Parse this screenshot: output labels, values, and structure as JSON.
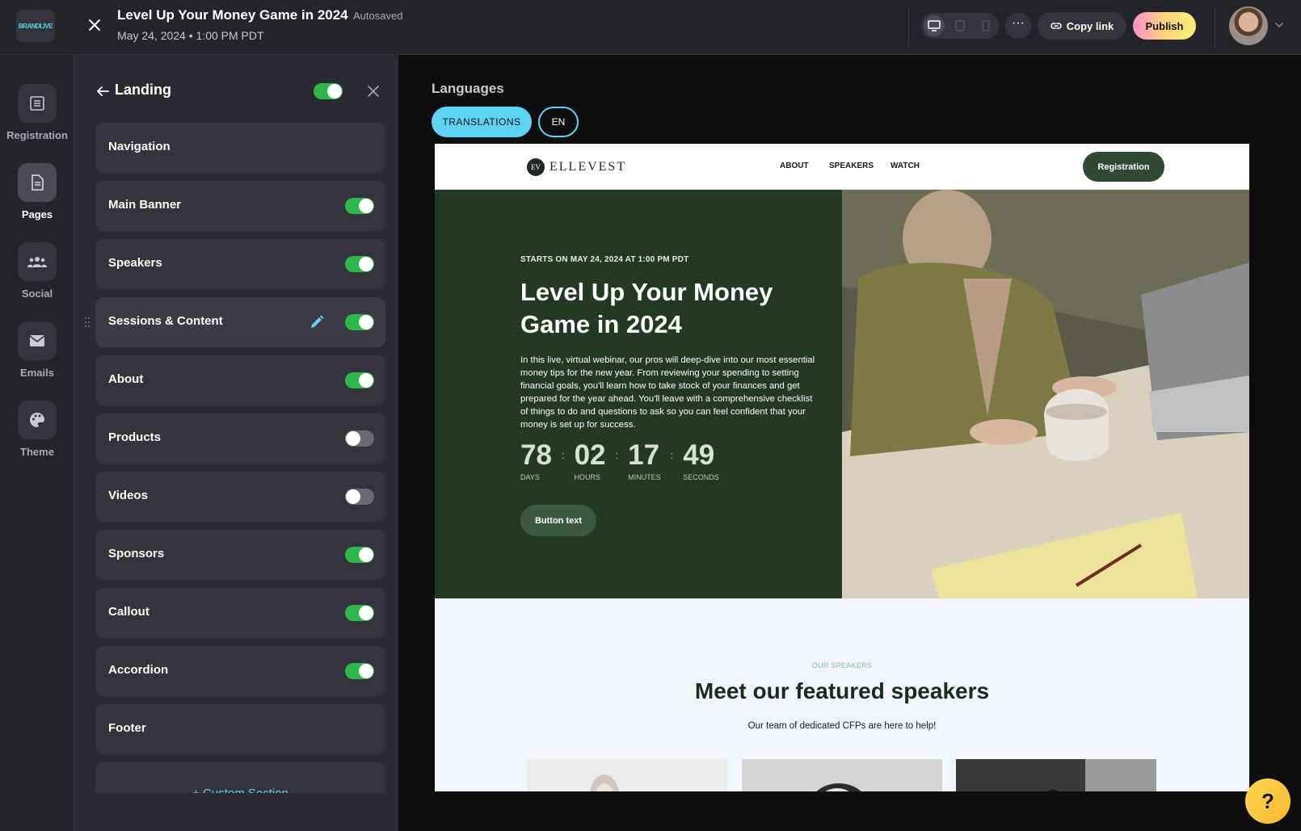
{
  "app": {
    "logo_text": "BRANDLIVE",
    "title": "Level Up Your Money Game in 2024",
    "autosave_status": "Autosaved",
    "date": "May 24, 2024 • 1:00 PM PDT"
  },
  "toolbar": {
    "more_label": "···",
    "copy_link_label": "Copy link",
    "publish_label": "Publish"
  },
  "rail": {
    "items": [
      {
        "label": "Registration",
        "icon": "list-icon"
      },
      {
        "label": "Pages",
        "icon": "document-icon",
        "active": true
      },
      {
        "label": "Social",
        "icon": "people-icon"
      },
      {
        "label": "Emails",
        "icon": "mail-icon"
      },
      {
        "label": "Theme",
        "icon": "palette-icon"
      }
    ]
  },
  "panel": {
    "title": "Landing",
    "page_enabled": true,
    "sections": [
      {
        "label": "Navigation"
      },
      {
        "label": "Main Banner",
        "enabled": true
      },
      {
        "label": "Speakers",
        "enabled": true
      },
      {
        "label": "Sessions & Content",
        "enabled": true,
        "editing": true
      },
      {
        "label": "About",
        "enabled": true
      },
      {
        "label": "Products",
        "enabled": false
      },
      {
        "label": "Videos",
        "enabled": false
      },
      {
        "label": "Sponsors",
        "enabled": true
      },
      {
        "label": "Callout",
        "enabled": true
      },
      {
        "label": "Accordion",
        "enabled": true
      },
      {
        "label": "Footer"
      }
    ],
    "custom_section_label": "+ Custom Section"
  },
  "languages": {
    "title": "Languages",
    "translations_label": "TRANSLATIONS",
    "current": "EN"
  },
  "preview": {
    "nav": {
      "logo_mark": "EV",
      "logo_text": "ELLEVEST",
      "links": [
        "ABOUT",
        "SPEAKERS",
        "WATCH"
      ],
      "registration_label": "Registration"
    },
    "hero": {
      "starts_on": "STARTS ON  MAY 24, 2024 AT 1:00 PM PDT",
      "heading": "Level Up Your Money Game in 2024",
      "description": "In this live, virtual webinar, our pros will deep-dive into our most essential money tips for the new year. From reviewing your spending to setting financial goals, you'll learn how to take stock of your finances and get prepared for the year ahead. You'll leave with a comprehensive checklist of things to do and questions to ask so you can feel confident that your money is set up for success.",
      "countdown": [
        {
          "value": "78",
          "label": "DAYS"
        },
        {
          "value": "02",
          "label": "HOURS"
        },
        {
          "value": "17",
          "label": "MINUTES"
        },
        {
          "value": "49",
          "label": "SECONDS"
        }
      ],
      "button_label": "Button text"
    },
    "speakers": {
      "eyebrow": "OUR SPEAKERS",
      "heading": "Meet our featured speakers",
      "subheading": "Our team of dedicated CFPs are here to help!"
    }
  },
  "help": {
    "label": "?"
  },
  "colors": {
    "accent": "#5ed3f3",
    "toggle_on": "#2cb84a",
    "hero_bg": "#223a24",
    "publish_gradient": [
      "#ff8fd1",
      "#ffd37a"
    ]
  }
}
